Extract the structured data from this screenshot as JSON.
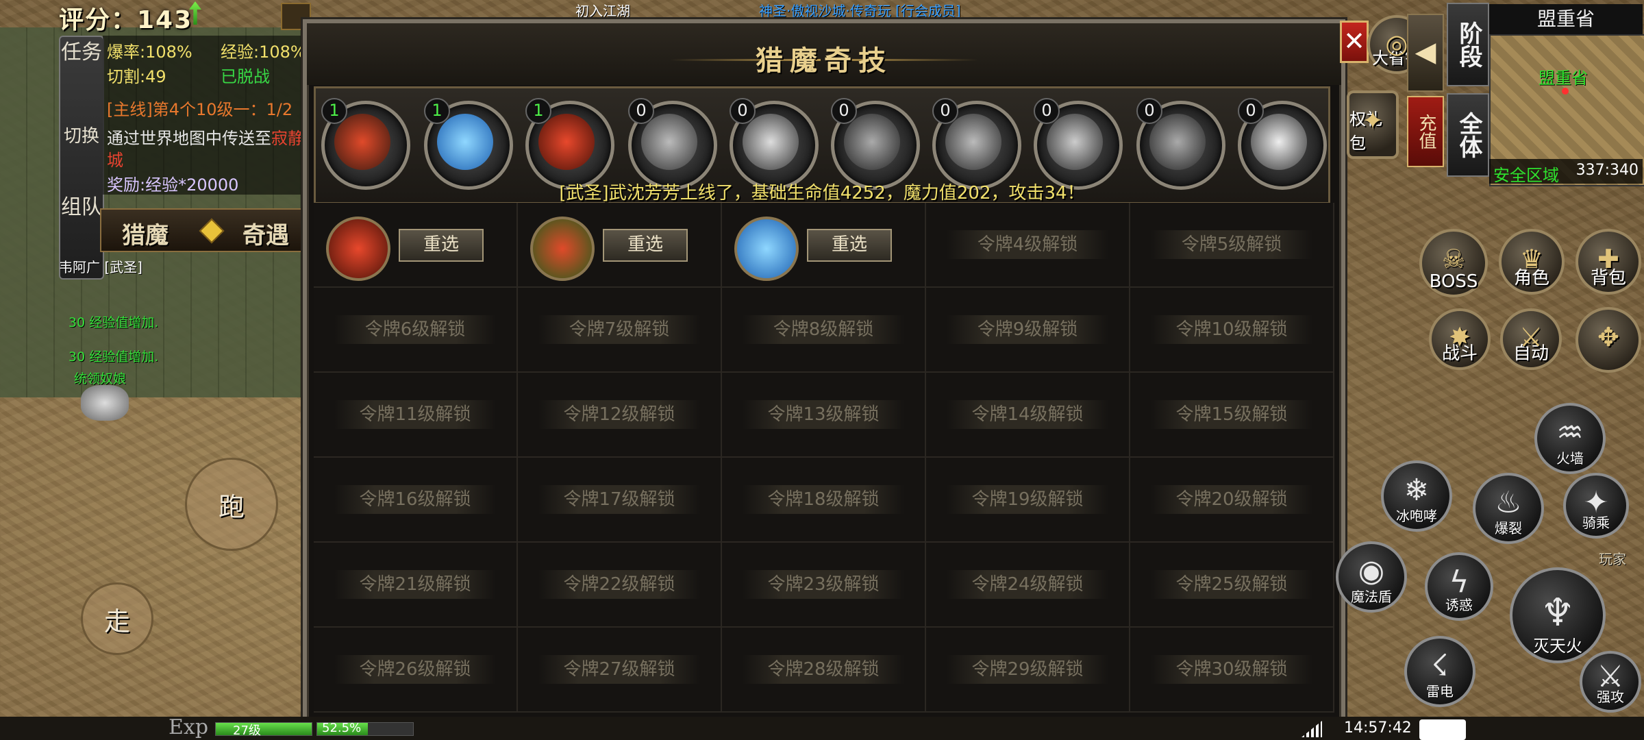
{
  "hud": {
    "score": "评分：143",
    "top_chat_1": "初入江湖",
    "top_chat_2": "神圣·傲视沙城·传奇玩 [行会成员]",
    "stats": {
      "drop_rate": "爆率:108%",
      "exp_rate": "经验:108%",
      "cut": "切割:49",
      "status": "已脱战"
    },
    "side_tabs": [
      "任务",
      "切换",
      "组队"
    ],
    "quest": {
      "title": "[主线]第4个10级一：1/2",
      "desc_1": "通过世界地图中传送至",
      "desc_place": "寂静",
      "desc_2": "城",
      "reward": "奖励:经验*20000"
    },
    "tab_hunt": "猎魔",
    "tab_adventure": "奇遇",
    "player_name": "韦阿广 [武圣]",
    "exp_msg_1": "30 经验值增加.",
    "exp_msg_2": "30 经验值增加.",
    "npc_name": "统领奴娘",
    "joy_run": "跑",
    "joy_walk": "走"
  },
  "dialog": {
    "title": "猎魔奇技",
    "close": "✕",
    "announcement": "[武圣]武沈芳芳上线了，基础生命值4252，魔力值202，攻击34！",
    "skill_levels": [
      "1",
      "1",
      "1",
      "0",
      "0",
      "0",
      "0",
      "0",
      "0",
      "0"
    ],
    "reselect": "重选",
    "locked": [
      "令牌4级解锁",
      "令牌5级解锁",
      "令牌6级解锁",
      "令牌7级解锁",
      "令牌8级解锁",
      "令牌9级解锁",
      "令牌10级解锁",
      "令牌11级解锁",
      "令牌12级解锁",
      "令牌13级解锁",
      "令牌14级解锁",
      "令牌15级解锁",
      "令牌16级解锁",
      "令牌17级解锁",
      "令牌18级解锁",
      "令牌19级解锁",
      "令牌20级解锁",
      "令牌21级解锁",
      "令牌22级解锁",
      "令牌23级解锁",
      "令牌24级解锁",
      "令牌25级解锁",
      "令牌26级解锁",
      "令牌27级解锁",
      "令牌28级解锁",
      "令牌29级解锁",
      "令牌30级解锁"
    ]
  },
  "right": {
    "province": "盟重省",
    "map_label": "盟重省",
    "safe_zone": "安全区域",
    "coords": "337:340",
    "stage": "阶段",
    "all": "全体",
    "recharge": "充值",
    "province_money": "大省钱",
    "privilege_pack": "权礼包",
    "boss": "BOSS",
    "role": "角色",
    "bag": "背包",
    "battle": "战斗",
    "auto": "自动",
    "fire_wall": "火墙",
    "ice_roar": "冰咆哮",
    "burst": "爆裂",
    "ride": "骑乘",
    "magic_shield": "魔法盾",
    "tempt": "诱惑",
    "extinguish_fire": "灭天火",
    "thunder": "雷电",
    "strong_attack": "强攻",
    "play": "玩家"
  },
  "bottom": {
    "exp_label": "Exp",
    "level": "27级",
    "exp_percent": "52.5%",
    "exp_fill": 0.525,
    "time": "14:57:42"
  }
}
